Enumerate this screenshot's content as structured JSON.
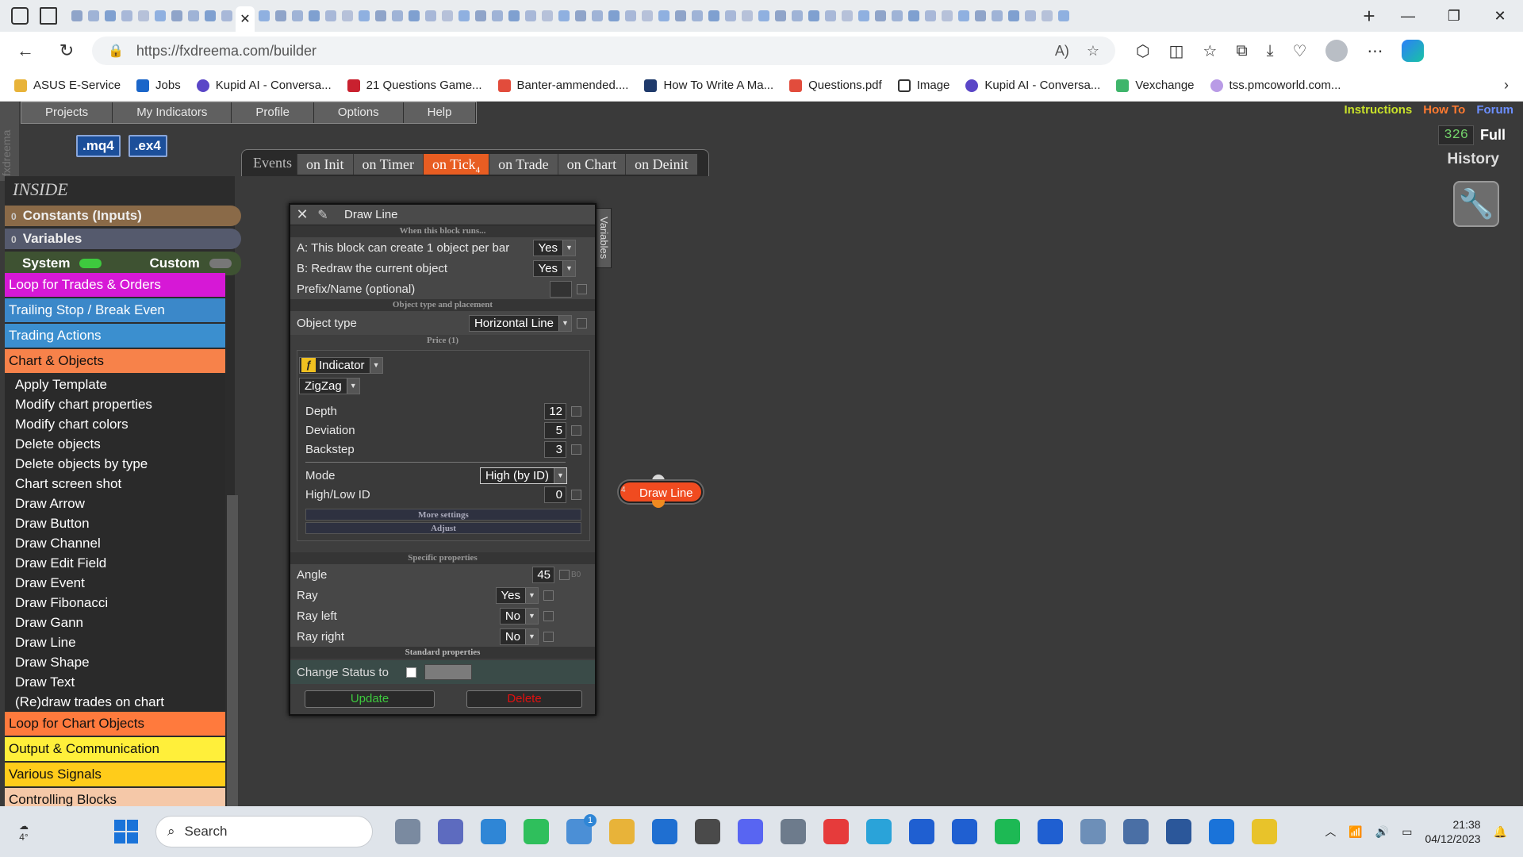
{
  "browser": {
    "url": "https://fxdreema.com/builder",
    "bookmarks": [
      {
        "label": "ASUS E-Service",
        "icon": "folder-icon"
      },
      {
        "label": "Jobs",
        "icon": "linkedin-icon"
      },
      {
        "label": "Kupid AI - Conversa...",
        "icon": "kupid-icon"
      },
      {
        "label": "21 Questions Game...",
        "icon": "rt-icon"
      },
      {
        "label": "Banter-ammended....",
        "icon": "pdf-icon"
      },
      {
        "label": "How To Write A Ma...",
        "icon": "v-icon"
      },
      {
        "label": "Questions.pdf",
        "icon": "pdf-icon"
      },
      {
        "label": "Image",
        "icon": "document-icon"
      },
      {
        "label": "Kupid AI - Conversa...",
        "icon": "kupid-icon"
      },
      {
        "label": "Vexchange",
        "icon": "vexchange-icon"
      },
      {
        "label": "tss.pmcoworld.com...",
        "icon": "globe-icon"
      }
    ]
  },
  "app": {
    "side_logo": "fxdreema",
    "menu": [
      "Projects",
      "My Indicators",
      "Profile",
      "Options",
      "Help"
    ],
    "top_links": [
      {
        "label": "Instructions",
        "color": "#c8e12a"
      },
      {
        "label": "How To",
        "color": "#ff7a30"
      },
      {
        "label": "Forum",
        "color": "#6c8fff"
      }
    ],
    "format_buttons": [
      ".mq4",
      ".ex4"
    ],
    "counter": "326",
    "full_label": "Full",
    "history_label": "History",
    "events_label": "Events",
    "event_tabs": [
      {
        "label": "on Init",
        "active": false
      },
      {
        "label": "on Timer",
        "active": false
      },
      {
        "label": "on Tick",
        "badge": "4",
        "active": true
      },
      {
        "label": "on Trade",
        "active": false
      },
      {
        "label": "on Chart",
        "active": false
      },
      {
        "label": "on Deinit",
        "active": false
      }
    ]
  },
  "sidebar": {
    "inside_label": "INSIDE",
    "constants_label": "Constants (Inputs)",
    "constants_count": "0",
    "variables_label": "Variables",
    "variables_count": "0",
    "system_label": "System",
    "custom_label": "Custom",
    "categories_top": [
      {
        "label": "Loop for Trades & Orders",
        "color": "mag"
      },
      {
        "label": "Trailing Stop / Break Even",
        "color": "blue"
      },
      {
        "label": "Trading Actions",
        "color": "blue2"
      },
      {
        "label": "Chart & Objects",
        "color": "orange"
      }
    ],
    "items": [
      "Apply Template",
      "Modify chart properties",
      "Modify chart colors",
      "Delete objects",
      "Delete objects by type",
      "Chart screen shot",
      "Draw Arrow",
      "Draw Button",
      "Draw Channel",
      "Draw Edit Field",
      "Draw Event",
      "Draw Fibonacci",
      "Draw Gann",
      "Draw Line",
      "Draw Shape",
      "Draw Text",
      "(Re)draw trades on chart"
    ],
    "categories_bottom": [
      {
        "label": "Loop for Chart Objects",
        "color": "orange2"
      },
      {
        "label": "Output & Communication",
        "color": "yellow"
      },
      {
        "label": "Various Signals",
        "color": "gold"
      },
      {
        "label": "Controlling Blocks",
        "color": "peach"
      }
    ]
  },
  "dialog": {
    "title": "Draw Line",
    "variables_tab": "Variables",
    "when_runs": "When this block runs...",
    "opt_a_label": "A: This block can create 1 object per bar",
    "opt_a_value": "Yes",
    "opt_b_label": "B: Redraw the current object",
    "opt_b_value": "Yes",
    "prefix_label": "Prefix/Name (optional)",
    "type_section": "Object type and placement",
    "object_type_label": "Object type",
    "object_type_value": "Horizontal Line",
    "price_section": "Price (1)",
    "fx_symbol": "ƒ",
    "source_value": "Indicator",
    "indicator_value": "ZigZag",
    "params": [
      {
        "label": "Depth",
        "value": "12"
      },
      {
        "label": "Deviation",
        "value": "5"
      },
      {
        "label": "Backstep",
        "value": "3"
      }
    ],
    "mode_label": "Mode",
    "mode_value": "High (by ID)",
    "hlid_label": "High/Low ID",
    "hlid_value": "0",
    "more_settings": "More settings",
    "adjust": "Adjust",
    "specific_section": "Specific properties",
    "angle_label": "Angle",
    "angle_value": "45",
    "angle_tag": "B0",
    "ray_label": "Ray",
    "ray_value": "Yes",
    "ray_left_label": "Ray left",
    "ray_left_value": "No",
    "ray_right_label": "Ray right",
    "ray_right_value": "No",
    "standard_section": "Standard properties",
    "status_label": "Change Status to",
    "update_label": "Update",
    "delete_label": "Delete"
  },
  "canvas_block": {
    "id": "4",
    "label": "Draw Line"
  },
  "taskbar": {
    "weather": "4°",
    "search_label": "Search",
    "notification_badge": "1",
    "time": "21:38",
    "date": "04/12/2023"
  },
  "colors": {
    "accent": "#e85d22",
    "update": "#3ec93e",
    "delete": "#e01010"
  }
}
